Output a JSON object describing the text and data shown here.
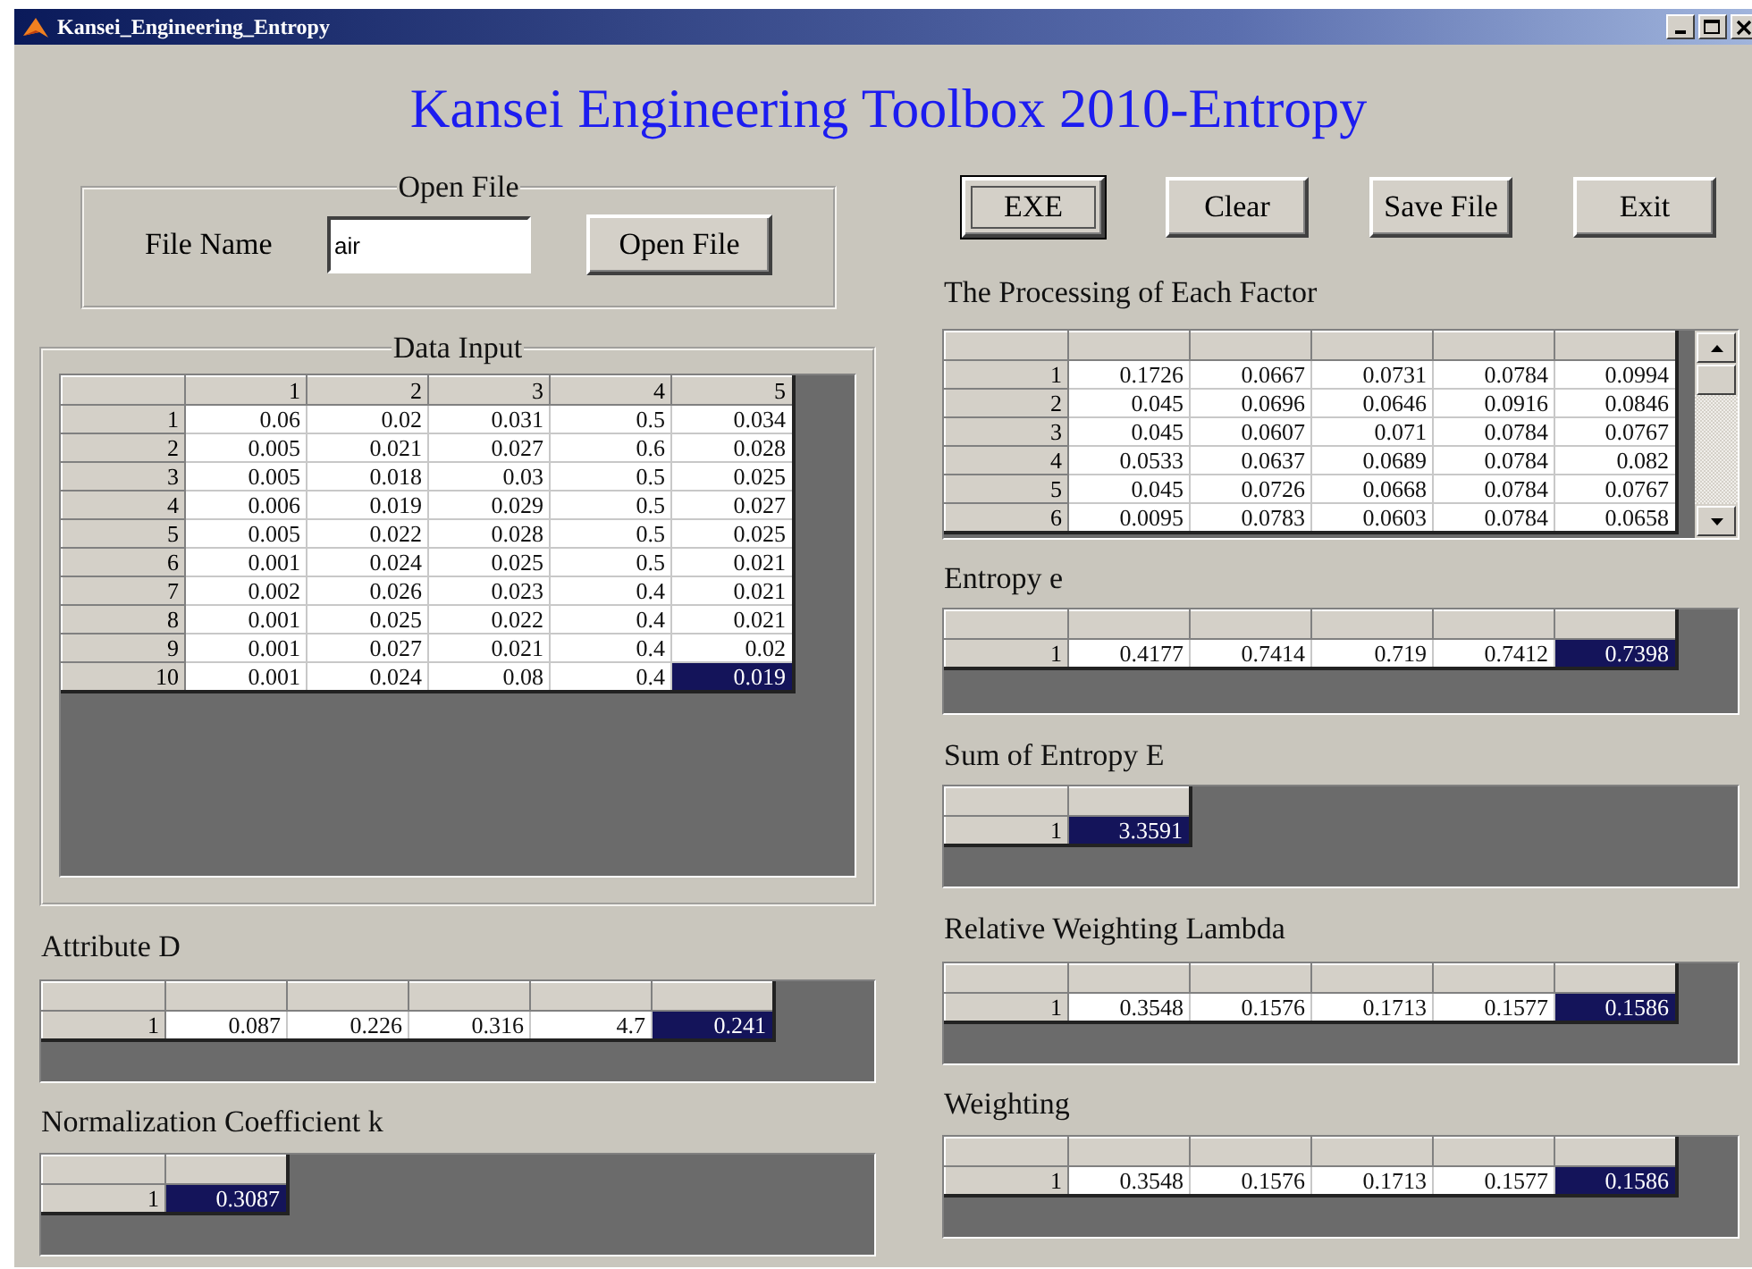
{
  "window": {
    "title": "Kansei_Engineering_Entropy"
  },
  "heading": "Kansei Engineering Toolbox 2010-Entropy",
  "open_file": {
    "title": "Open File",
    "label": "File Name",
    "value": "air",
    "button": "Open File"
  },
  "buttons": [
    {
      "label": "EXE",
      "focused": true
    },
    {
      "label": "Clear",
      "focused": false
    },
    {
      "label": "Save File",
      "focused": false
    },
    {
      "label": "Exit",
      "focused": false
    }
  ],
  "data_input": {
    "title": "Data Input",
    "table": {
      "columns": [
        "1",
        "2",
        "3",
        "4",
        "5"
      ],
      "rows": [
        {
          "label": "1",
          "cells": [
            {
              "text": "0.06",
              "selected": false
            },
            {
              "text": "0.02",
              "selected": false
            },
            {
              "text": "0.031",
              "selected": false
            },
            {
              "text": "0.5",
              "selected": false
            },
            {
              "text": "0.034",
              "selected": false
            }
          ]
        },
        {
          "label": "2",
          "cells": [
            {
              "text": "0.005",
              "selected": false
            },
            {
              "text": "0.021",
              "selected": false
            },
            {
              "text": "0.027",
              "selected": false
            },
            {
              "text": "0.6",
              "selected": false
            },
            {
              "text": "0.028",
              "selected": false
            }
          ]
        },
        {
          "label": "3",
          "cells": [
            {
              "text": "0.005",
              "selected": false
            },
            {
              "text": "0.018",
              "selected": false
            },
            {
              "text": "0.03",
              "selected": false
            },
            {
              "text": "0.5",
              "selected": false
            },
            {
              "text": "0.025",
              "selected": false
            }
          ]
        },
        {
          "label": "4",
          "cells": [
            {
              "text": "0.006",
              "selected": false
            },
            {
              "text": "0.019",
              "selected": false
            },
            {
              "text": "0.029",
              "selected": false
            },
            {
              "text": "0.5",
              "selected": false
            },
            {
              "text": "0.027",
              "selected": false
            }
          ]
        },
        {
          "label": "5",
          "cells": [
            {
              "text": "0.005",
              "selected": false
            },
            {
              "text": "0.022",
              "selected": false
            },
            {
              "text": "0.028",
              "selected": false
            },
            {
              "text": "0.5",
              "selected": false
            },
            {
              "text": "0.025",
              "selected": false
            }
          ]
        },
        {
          "label": "6",
          "cells": [
            {
              "text": "0.001",
              "selected": false
            },
            {
              "text": "0.024",
              "selected": false
            },
            {
              "text": "0.025",
              "selected": false
            },
            {
              "text": "0.5",
              "selected": false
            },
            {
              "text": "0.021",
              "selected": false
            }
          ]
        },
        {
          "label": "7",
          "cells": [
            {
              "text": "0.002",
              "selected": false
            },
            {
              "text": "0.026",
              "selected": false
            },
            {
              "text": "0.023",
              "selected": false
            },
            {
              "text": "0.4",
              "selected": false
            },
            {
              "text": "0.021",
              "selected": false
            }
          ]
        },
        {
          "label": "8",
          "cells": [
            {
              "text": "0.001",
              "selected": false
            },
            {
              "text": "0.025",
              "selected": false
            },
            {
              "text": "0.022",
              "selected": false
            },
            {
              "text": "0.4",
              "selected": false
            },
            {
              "text": "0.021",
              "selected": false
            }
          ]
        },
        {
          "label": "9",
          "cells": [
            {
              "text": "0.001",
              "selected": false
            },
            {
              "text": "0.027",
              "selected": false
            },
            {
              "text": "0.021",
              "selected": false
            },
            {
              "text": "0.4",
              "selected": false
            },
            {
              "text": "0.02",
              "selected": false
            }
          ]
        },
        {
          "label": "10",
          "cells": [
            {
              "text": "0.001",
              "selected": false
            },
            {
              "text": "0.024",
              "selected": false
            },
            {
              "text": "0.08",
              "selected": false
            },
            {
              "text": "0.4",
              "selected": false
            },
            {
              "text": "0.019",
              "selected": true
            }
          ]
        }
      ]
    }
  },
  "attribute_d": {
    "label": "Attribute D",
    "table": {
      "rows": [
        {
          "label": "1",
          "cells": [
            {
              "text": "0.087",
              "selected": false
            },
            {
              "text": "0.226",
              "selected": false
            },
            {
              "text": "0.316",
              "selected": false
            },
            {
              "text": "4.7",
              "selected": false
            },
            {
              "text": "0.241",
              "selected": true
            }
          ]
        }
      ]
    }
  },
  "normalization": {
    "label": "Normalization Coefficient k",
    "table": {
      "rows": [
        {
          "label": "1",
          "cells": [
            {
              "text": "0.3087",
              "selected": true
            }
          ]
        }
      ]
    }
  },
  "processing": {
    "label": "The Processing of Each Factor",
    "table": {
      "scrollbar": true,
      "rows": [
        {
          "label": "1",
          "cells": [
            {
              "text": "0.1726",
              "selected": false
            },
            {
              "text": "0.0667",
              "selected": false
            },
            {
              "text": "0.0731",
              "selected": false
            },
            {
              "text": "0.0784",
              "selected": false
            },
            {
              "text": "0.0994",
              "selected": false
            }
          ]
        },
        {
          "label": "2",
          "cells": [
            {
              "text": "0.045",
              "selected": false
            },
            {
              "text": "0.0696",
              "selected": false
            },
            {
              "text": "0.0646",
              "selected": false
            },
            {
              "text": "0.0916",
              "selected": false
            },
            {
              "text": "0.0846",
              "selected": false
            }
          ]
        },
        {
          "label": "3",
          "cells": [
            {
              "text": "0.045",
              "selected": false
            },
            {
              "text": "0.0607",
              "selected": false
            },
            {
              "text": "0.071",
              "selected": false
            },
            {
              "text": "0.0784",
              "selected": false
            },
            {
              "text": "0.0767",
              "selected": false
            }
          ]
        },
        {
          "label": "4",
          "cells": [
            {
              "text": "0.0533",
              "selected": false
            },
            {
              "text": "0.0637",
              "selected": false
            },
            {
              "text": "0.0689",
              "selected": false
            },
            {
              "text": "0.0784",
              "selected": false
            },
            {
              "text": "0.082",
              "selected": false
            }
          ]
        },
        {
          "label": "5",
          "cells": [
            {
              "text": "0.045",
              "selected": false
            },
            {
              "text": "0.0726",
              "selected": false
            },
            {
              "text": "0.0668",
              "selected": false
            },
            {
              "text": "0.0784",
              "selected": false
            },
            {
              "text": "0.0767",
              "selected": false
            }
          ]
        },
        {
          "label": "6",
          "cells": [
            {
              "text": "0.0095",
              "selected": false
            },
            {
              "text": "0.0783",
              "selected": false
            },
            {
              "text": "0.0603",
              "selected": false
            },
            {
              "text": "0.0784",
              "selected": false
            },
            {
              "text": "0.0658",
              "selected": false
            }
          ]
        }
      ]
    }
  },
  "entropy": {
    "label": "Entropy e",
    "table": {
      "rows": [
        {
          "label": "1",
          "cells": [
            {
              "text": "0.4177",
              "selected": false
            },
            {
              "text": "0.7414",
              "selected": false
            },
            {
              "text": "0.719",
              "selected": false
            },
            {
              "text": "0.7412",
              "selected": false
            },
            {
              "text": "0.7398",
              "selected": true
            }
          ]
        }
      ]
    }
  },
  "sum_entropy": {
    "label": "Sum of Entropy E",
    "table": {
      "rows": [
        {
          "label": "1",
          "cells": [
            {
              "text": "3.3591",
              "selected": true
            }
          ]
        }
      ]
    }
  },
  "relative_weighting": {
    "label": "Relative Weighting Lambda",
    "table": {
      "rows": [
        {
          "label": "1",
          "cells": [
            {
              "text": "0.3548",
              "selected": false
            },
            {
              "text": "0.1576",
              "selected": false
            },
            {
              "text": "0.1713",
              "selected": false
            },
            {
              "text": "0.1577",
              "selected": false
            },
            {
              "text": "0.1586",
              "selected": true
            }
          ]
        }
      ]
    }
  },
  "weighting": {
    "label": "Weighting",
    "table": {
      "rows": [
        {
          "label": "1",
          "cells": [
            {
              "text": "0.3548",
              "selected": false
            },
            {
              "text": "0.1576",
              "selected": false
            },
            {
              "text": "0.1713",
              "selected": false
            },
            {
              "text": "0.1577",
              "selected": false
            },
            {
              "text": "0.1586",
              "selected": true
            }
          ]
        }
      ]
    }
  }
}
